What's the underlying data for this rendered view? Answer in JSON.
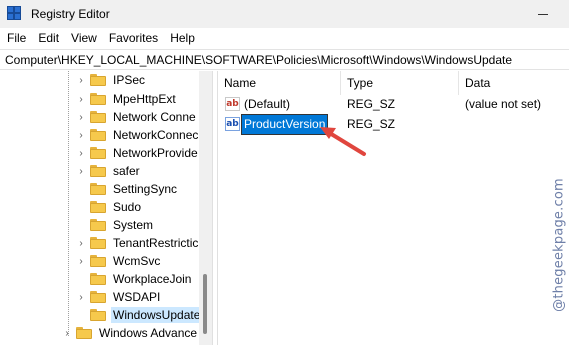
{
  "window": {
    "title": "Registry Editor"
  },
  "menu": [
    "File",
    "Edit",
    "View",
    "Favorites",
    "Help"
  ],
  "address": "Computer\\HKEY_LOCAL_MACHINE\\SOFTWARE\\Policies\\Microsoft\\Windows\\WindowsUpdate",
  "tree": {
    "items": [
      {
        "label": "IPSec",
        "expander": "›"
      },
      {
        "label": "MpeHttpExt",
        "expander": "›"
      },
      {
        "label": "Network Conne",
        "expander": "›"
      },
      {
        "label": "NetworkConnec",
        "expander": "›"
      },
      {
        "label": "NetworkProvide",
        "expander": "›"
      },
      {
        "label": "safer",
        "expander": "›"
      },
      {
        "label": "SettingSync",
        "expander": ""
      },
      {
        "label": "Sudo",
        "expander": ""
      },
      {
        "label": "System",
        "expander": ""
      },
      {
        "label": "TenantRestrictic",
        "expander": "›"
      },
      {
        "label": "WcmSvc",
        "expander": "›"
      },
      {
        "label": "WorkplaceJoin",
        "expander": ""
      },
      {
        "label": "WSDAPI",
        "expander": "›"
      },
      {
        "label": "WindowsUpdate",
        "expander": "",
        "selected": true
      }
    ],
    "parent_item": {
      "label": "Windows Advance",
      "expander": "›"
    }
  },
  "list": {
    "columns": {
      "name": "Name",
      "type": "Type",
      "data": "Data"
    },
    "rows": [
      {
        "name": "(Default)",
        "type": "REG_SZ",
        "data": "(value not set)",
        "icon": "ab-string-icon"
      },
      {
        "name": "ProductVersion",
        "type": "REG_SZ",
        "data": "",
        "icon": "ab-string-icon",
        "editing": true
      }
    ]
  },
  "watermark": "@thegeekpage.com",
  "colors": {
    "selection": "#0078d7",
    "arrow": "#e0463e",
    "folder": "#f6c94c"
  }
}
